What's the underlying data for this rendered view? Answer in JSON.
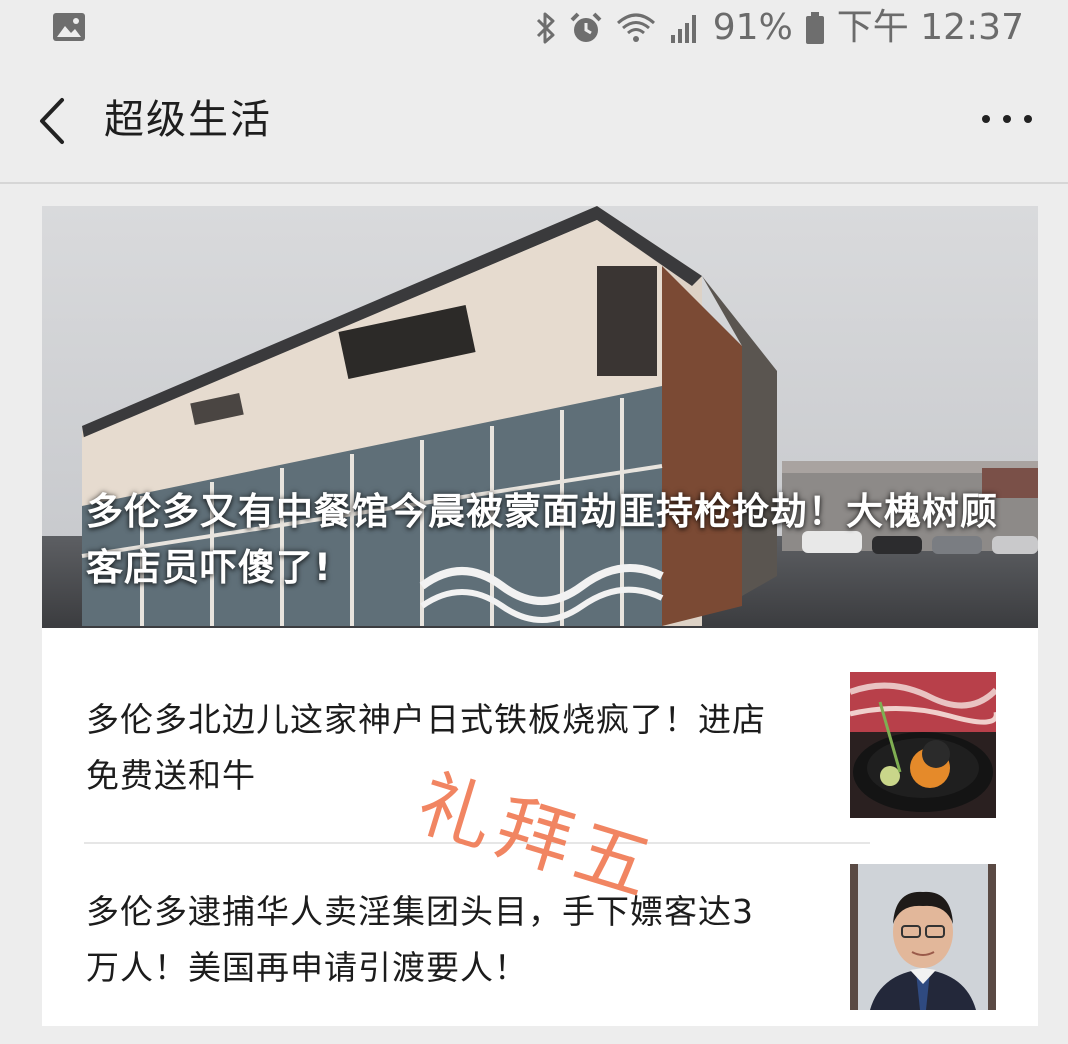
{
  "status_bar": {
    "battery_percent": "91%",
    "time": "下午 12:37",
    "icons": [
      "image-icon",
      "bluetooth-icon",
      "alarm-icon",
      "wifi-icon",
      "signal-icon",
      "battery-icon"
    ]
  },
  "nav": {
    "title": "超级生活",
    "back_icon": "chevron-left-icon",
    "more_icon": "more-dots-icon"
  },
  "feed": {
    "hero": {
      "title": "多伦多又有中餐馆今晨被蒙面劫匪持枪抢劫！大槐树顾客店员吓傻了!",
      "image": "restaurant-storefront-photo"
    },
    "items": [
      {
        "title": "多伦多北边儿这家神户日式铁板烧疯了！进店免费送和牛",
        "thumbnail": "wagyu-dish-photo"
      },
      {
        "title": "多伦多逮捕华人卖淫集团头目，手下嫖客达3万人！美国再申请引渡要人！",
        "thumbnail": "man-portrait-photo"
      }
    ],
    "stamp_text": "礼拜五"
  },
  "colors": {
    "background": "#ededed",
    "stamp": "#f07b55",
    "text_primary": "#1c1c1c"
  }
}
